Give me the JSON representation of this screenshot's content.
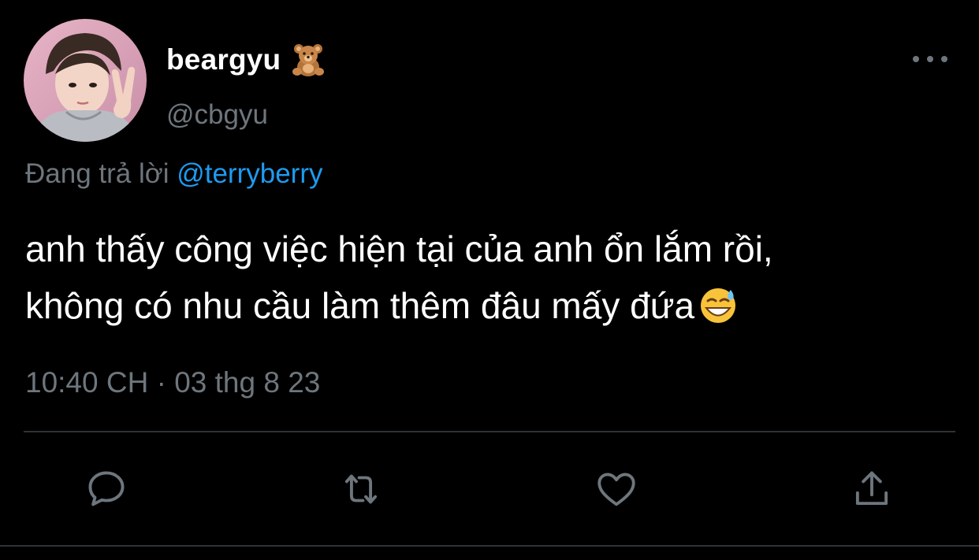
{
  "user": {
    "display_name": "beargyu",
    "name_emoji": "teddy-bear-emoji",
    "handle": "@cbgyu",
    "avatar": "profile-photo"
  },
  "reply": {
    "prefix": "Đang trả lời",
    "mention": "@terryberry"
  },
  "tweet": {
    "text_lines": [
      "anh thấy công việc hiện tại của anh ổn lắm rồi,",
      "không có nhu cầu làm thêm đâu mấy đứa"
    ],
    "trailing_emoji": "grinning-sweat-emoji",
    "timestamp": "10:40 CH · 03 thg 8 23"
  },
  "actions": [
    {
      "name": "reply",
      "icon": "reply-icon"
    },
    {
      "name": "retweet",
      "icon": "retweet-icon"
    },
    {
      "name": "like",
      "icon": "heart-icon"
    },
    {
      "name": "share",
      "icon": "share-icon"
    }
  ],
  "colors": {
    "background": "#000000",
    "text": "#ffffff",
    "secondary": "#6e767d",
    "link": "#1d9bf0",
    "divider": "#2f3336"
  }
}
